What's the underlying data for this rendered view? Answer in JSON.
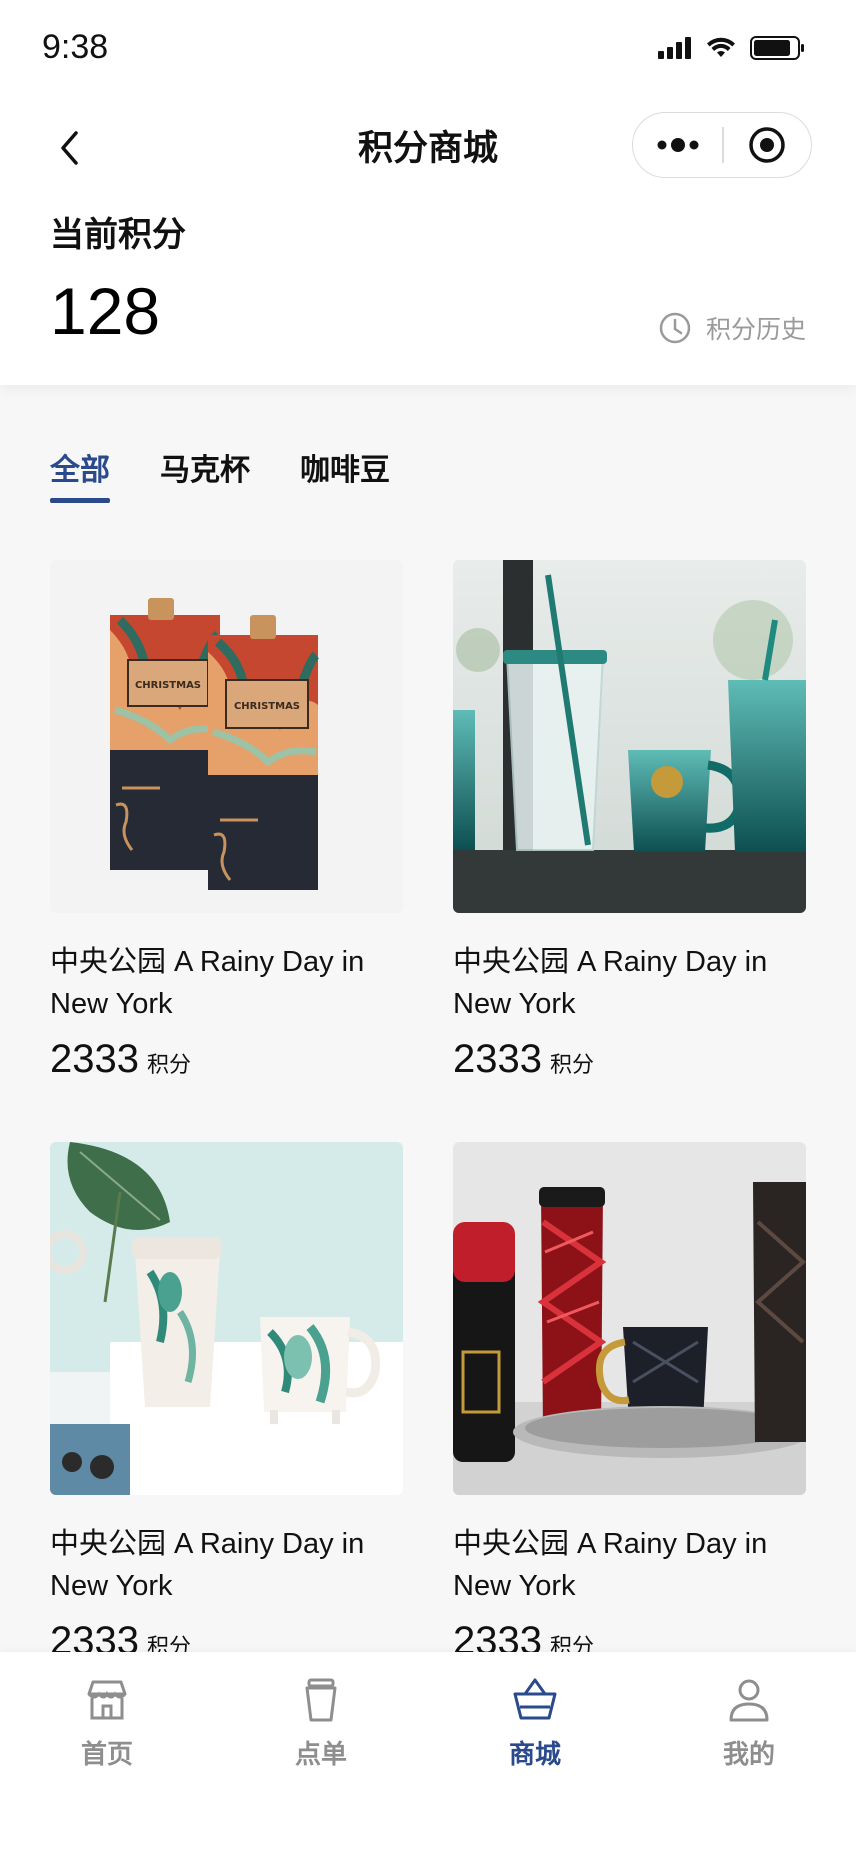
{
  "status_bar": {
    "time": "9:38"
  },
  "nav": {
    "title": "积分商城"
  },
  "points": {
    "label": "当前积分",
    "value": "128",
    "history_label": "积分历史"
  },
  "tabs": [
    {
      "label": "全部",
      "active": true
    },
    {
      "label": "马克杯",
      "active": false
    },
    {
      "label": "咖啡豆",
      "active": false
    }
  ],
  "products": [
    {
      "name": "中央公园 A Rainy Day in New York",
      "price": "2333",
      "unit": "积分",
      "image": "christmas-coffee-bags"
    },
    {
      "name": "中央公园 A Rainy Day in New York",
      "price": "2333",
      "unit": "积分",
      "image": "teal-glass-cups"
    },
    {
      "name": "中央公园 A Rainy Day in New York",
      "price": "2333",
      "unit": "积分",
      "image": "leaf-pattern-mugs"
    },
    {
      "name": "中央公园 A Rainy Day in New York",
      "price": "2333",
      "unit": "积分",
      "image": "red-black-tumblers"
    }
  ],
  "tab_bar": [
    {
      "label": "首页",
      "icon": "store-icon",
      "active": false
    },
    {
      "label": "点单",
      "icon": "cup-icon",
      "active": false
    },
    {
      "label": "商城",
      "icon": "basket-icon",
      "active": true
    },
    {
      "label": "我的",
      "icon": "user-icon",
      "active": false
    }
  ],
  "colors": {
    "accent": "#2a4a8c",
    "muted": "#8e8e8e"
  }
}
